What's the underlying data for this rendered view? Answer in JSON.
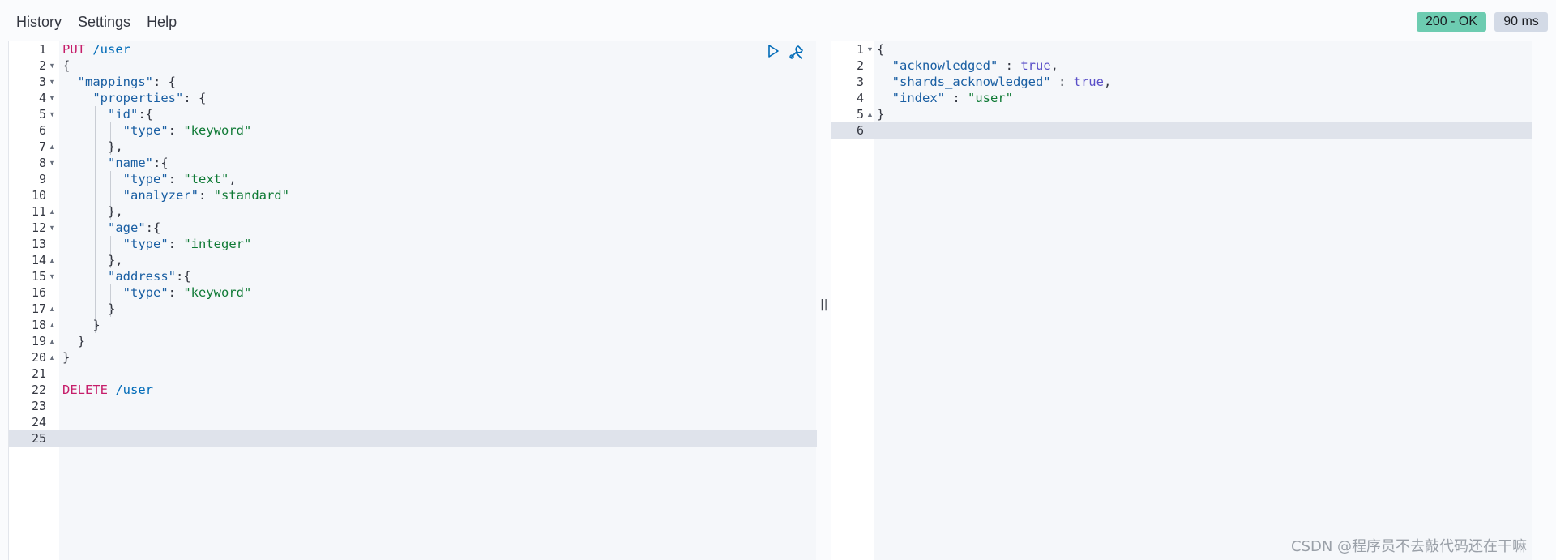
{
  "menu": {
    "history": "History",
    "settings": "Settings",
    "help": "Help"
  },
  "response_status": {
    "code": "200 - OK",
    "time": "90 ms",
    "ok_color": "#6dccb1"
  },
  "splitter_glyph": "||",
  "watermark": "CSDN @程序员不去敲代码还在干嘛",
  "request_editor": {
    "active_line": 25,
    "lines": [
      {
        "n": "1",
        "fold": "",
        "tokens": [
          [
            "kw",
            "PUT"
          ],
          [
            "punc",
            " "
          ],
          [
            "path",
            "/user"
          ]
        ]
      },
      {
        "n": "2",
        "fold": "▼",
        "tokens": [
          [
            "punc",
            "{"
          ]
        ]
      },
      {
        "n": "3",
        "fold": "▼",
        "tokens": [
          [
            "punc",
            "  "
          ],
          [
            "key",
            "\"mappings\""
          ],
          [
            "punc",
            ": {"
          ]
        ]
      },
      {
        "n": "4",
        "fold": "▼",
        "tokens": [
          [
            "punc",
            "    "
          ],
          [
            "key",
            "\"properties\""
          ],
          [
            "punc",
            ": {"
          ]
        ]
      },
      {
        "n": "5",
        "fold": "▼",
        "tokens": [
          [
            "punc",
            "      "
          ],
          [
            "key",
            "\"id\""
          ],
          [
            "punc",
            ":{"
          ]
        ]
      },
      {
        "n": "6",
        "fold": "",
        "tokens": [
          [
            "punc",
            "        "
          ],
          [
            "key",
            "\"type\""
          ],
          [
            "punc",
            ": "
          ],
          [
            "str",
            "\"keyword\""
          ]
        ]
      },
      {
        "n": "7",
        "fold": "▲",
        "tokens": [
          [
            "punc",
            "      },"
          ]
        ]
      },
      {
        "n": "8",
        "fold": "▼",
        "tokens": [
          [
            "punc",
            "      "
          ],
          [
            "key",
            "\"name\""
          ],
          [
            "punc",
            ":{"
          ]
        ]
      },
      {
        "n": "9",
        "fold": "",
        "tokens": [
          [
            "punc",
            "        "
          ],
          [
            "key",
            "\"type\""
          ],
          [
            "punc",
            ": "
          ],
          [
            "str",
            "\"text\""
          ],
          [
            "punc",
            ","
          ]
        ]
      },
      {
        "n": "10",
        "fold": "",
        "tokens": [
          [
            "punc",
            "        "
          ],
          [
            "key",
            "\"analyzer\""
          ],
          [
            "punc",
            ": "
          ],
          [
            "str",
            "\"standard\""
          ]
        ]
      },
      {
        "n": "11",
        "fold": "▲",
        "tokens": [
          [
            "punc",
            "      },"
          ]
        ]
      },
      {
        "n": "12",
        "fold": "▼",
        "tokens": [
          [
            "punc",
            "      "
          ],
          [
            "key",
            "\"age\""
          ],
          [
            "punc",
            ":{"
          ]
        ]
      },
      {
        "n": "13",
        "fold": "",
        "tokens": [
          [
            "punc",
            "        "
          ],
          [
            "key",
            "\"type\""
          ],
          [
            "punc",
            ": "
          ],
          [
            "str",
            "\"integer\""
          ]
        ]
      },
      {
        "n": "14",
        "fold": "▲",
        "tokens": [
          [
            "punc",
            "      },"
          ]
        ]
      },
      {
        "n": "15",
        "fold": "▼",
        "tokens": [
          [
            "punc",
            "      "
          ],
          [
            "key",
            "\"address\""
          ],
          [
            "punc",
            ":{"
          ]
        ]
      },
      {
        "n": "16",
        "fold": "",
        "tokens": [
          [
            "punc",
            "        "
          ],
          [
            "key",
            "\"type\""
          ],
          [
            "punc",
            ": "
          ],
          [
            "str",
            "\"keyword\""
          ]
        ]
      },
      {
        "n": "17",
        "fold": "▲",
        "tokens": [
          [
            "punc",
            "      }"
          ]
        ]
      },
      {
        "n": "18",
        "fold": "▲",
        "tokens": [
          [
            "punc",
            "    }"
          ]
        ]
      },
      {
        "n": "19",
        "fold": "▲",
        "tokens": [
          [
            "punc",
            "  }"
          ]
        ]
      },
      {
        "n": "20",
        "fold": "▲",
        "tokens": [
          [
            "punc",
            "}"
          ]
        ]
      },
      {
        "n": "21",
        "fold": "",
        "tokens": []
      },
      {
        "n": "22",
        "fold": "",
        "tokens": [
          [
            "kw",
            "DELETE"
          ],
          [
            "punc",
            " "
          ],
          [
            "path",
            "/user"
          ]
        ]
      },
      {
        "n": "23",
        "fold": "",
        "tokens": []
      },
      {
        "n": "24",
        "fold": "",
        "tokens": []
      },
      {
        "n": "25",
        "fold": "",
        "tokens": []
      }
    ]
  },
  "response_editor": {
    "active_line": 6,
    "lines": [
      {
        "n": "1",
        "fold": "▼",
        "tokens": [
          [
            "punc",
            "{"
          ]
        ]
      },
      {
        "n": "2",
        "fold": "",
        "tokens": [
          [
            "punc",
            "  "
          ],
          [
            "key",
            "\"acknowledged\""
          ],
          [
            "punc",
            " : "
          ],
          [
            "bool",
            "true"
          ],
          [
            "punc",
            ","
          ]
        ]
      },
      {
        "n": "3",
        "fold": "",
        "tokens": [
          [
            "punc",
            "  "
          ],
          [
            "key",
            "\"shards_acknowledged\""
          ],
          [
            "punc",
            " : "
          ],
          [
            "bool",
            "true"
          ],
          [
            "punc",
            ","
          ]
        ]
      },
      {
        "n": "4",
        "fold": "",
        "tokens": [
          [
            "punc",
            "  "
          ],
          [
            "key",
            "\"index\""
          ],
          [
            "punc",
            " : "
          ],
          [
            "str",
            "\"user\""
          ]
        ]
      },
      {
        "n": "5",
        "fold": "▲",
        "tokens": [
          [
            "punc",
            "}"
          ]
        ]
      },
      {
        "n": "6",
        "fold": "",
        "tokens": []
      }
    ]
  }
}
